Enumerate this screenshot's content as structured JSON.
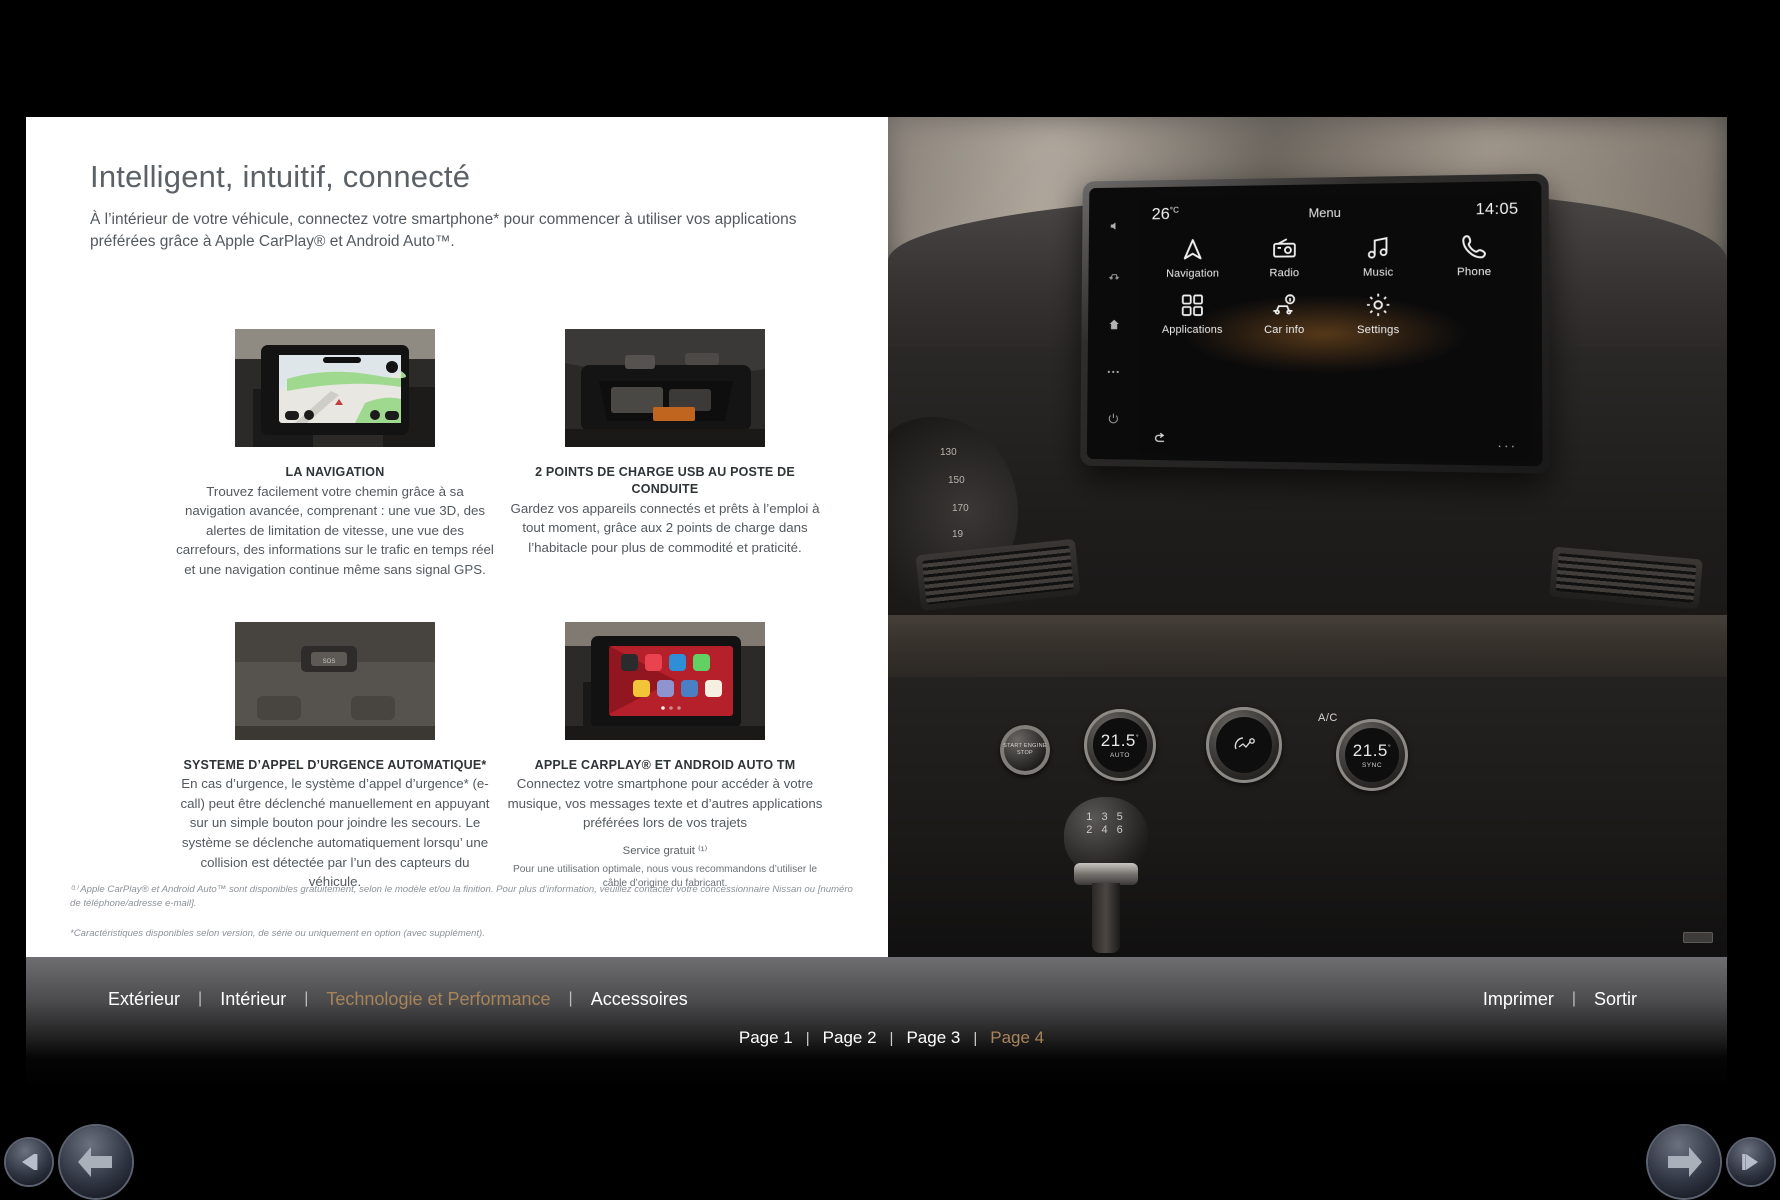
{
  "page": {
    "headline": "Intelligent, intuitif, connecté",
    "subhead_line1": "À l’intérieur de votre véhicule, connectez votre smartphone* pour commencer à utiliser vos applications",
    "subhead_line2": "préférées grâce à Apple CarPlay® et Android Auto™."
  },
  "features": [
    {
      "id": "navigation",
      "image_alt": "la-navigation-screen-photo",
      "title": "LA NAVIGATION",
      "body": "Trouvez facilement votre chemin grâce à sa navigation avancée, comprenant : une vue 3D, des alertes de limitation de vitesse, une vue des carrefours, des informations sur le trafic en temps réel et une navigation continue même sans signal GPS."
    },
    {
      "id": "usb-charge",
      "image_alt": "usb-charging-points-photo",
      "title": "2 POINTS DE CHARGE USB AU POSTE DE CONDUITE",
      "body": "Gardez vos appareils connectés et prêts à l’emploi à tout moment, grâce aux 2 points de charge dans l’habitacle pour plus de commodité et praticité."
    },
    {
      "id": "ecall",
      "image_alt": "emergency-call-button-photo",
      "title": "SYSTEME D’APPEL D’URGENCE AUTOMATIQUE*",
      "body": "En cas d’urgence, le système d’appel d’urgence* (e-call) peut être déclenché manuellement en appuyant sur un simple bouton pour joindre les secours. Le système se déclenche automatiquement lorsqu’ une collision est détectée par l’un des capteurs du véhicule."
    },
    {
      "id": "carplay",
      "image_alt": "apple-carplay-screen-photo",
      "title": "APPLE CARPLAY® ET ANDROID AUTO TM",
      "body": "Connectez votre smartphone pour accéder à votre musique, vos messages texte et d’autres applications préférées lors de vos trajets",
      "note": "Service gratuit ⁽¹⁾",
      "note2": "Pour une utilisation optimale, nous vous recommandons d’utiliser le câble d’origine du fabricant."
    }
  ],
  "footnotes": [
    "⁽¹⁾ Apple CarPlay® et Android Auto™ sont disponibles gratuitement, selon le modèle et/ou la finition. Pour plus d’information, veuillez contacter votre concessionnaire Nissan ou [numéro de téléphone/adresse e-mail].",
    "*Caractéristiques disponibles selon version, de série ou uniquement en option (avec supplément)."
  ],
  "headunit": {
    "temperature": "26",
    "temperature_unit": "°C",
    "menu_label": "Menu",
    "clock": "14:05",
    "tiles": [
      {
        "icon": "navigation-arrow-icon",
        "label": "Navigation"
      },
      {
        "icon": "radio-icon",
        "label": "Radio"
      },
      {
        "icon": "music-note-icon",
        "label": "Music"
      },
      {
        "icon": "phone-handset-icon",
        "label": "Phone"
      },
      {
        "icon": "apps-grid-icon",
        "label": "Applications"
      },
      {
        "icon": "car-info-icon",
        "label": "Car info"
      },
      {
        "icon": "gear-settings-icon",
        "label": "Settings"
      }
    ],
    "sidebar_icons": [
      "mute-speaker-icon",
      "drive-assist-icon",
      "home-icon",
      "apps-dots-icon",
      "power-icon"
    ],
    "bottom_icons": [
      "back-arrow-icon",
      "more-dots-icon"
    ]
  },
  "dashboard": {
    "start_button": "START ENGINE STOP",
    "temp_left": "21.5",
    "temp_right": "21.5",
    "temp_unit": "°",
    "left_knob_mode": "AUTO",
    "right_knob_mode": "SYNC",
    "ac_label": "A/C",
    "gear_pattern": "1 3 5\n2 4 6"
  },
  "navbar": {
    "sections": [
      {
        "label": "Extérieur",
        "active": false
      },
      {
        "label": "Intérieur",
        "active": false
      },
      {
        "label": "Technologie et Performance",
        "active": true
      },
      {
        "label": "Accessoires",
        "active": false
      }
    ],
    "actions": [
      {
        "label": "Imprimer"
      },
      {
        "label": "Sortir"
      }
    ],
    "pages": [
      {
        "label": "Page 1",
        "active": false
      },
      {
        "label": "Page 2",
        "active": false
      },
      {
        "label": "Page 3",
        "active": false
      },
      {
        "label": "Page 4",
        "active": true
      }
    ],
    "separator": "|"
  },
  "controls": [
    {
      "id": "first-page",
      "icon": "first-page-arrow-icon"
    },
    {
      "id": "previous-page",
      "icon": "previous-page-arrow-icon"
    },
    {
      "id": "next-page",
      "icon": "next-page-arrow-icon"
    },
    {
      "id": "last-page",
      "icon": "last-page-arrow-icon"
    }
  ],
  "colors": {
    "accent": "#a8845a",
    "page_background": "#ffffff",
    "viewer_background": "#000000",
    "body_text": "#53595e",
    "heading_text": "#5b6166"
  }
}
